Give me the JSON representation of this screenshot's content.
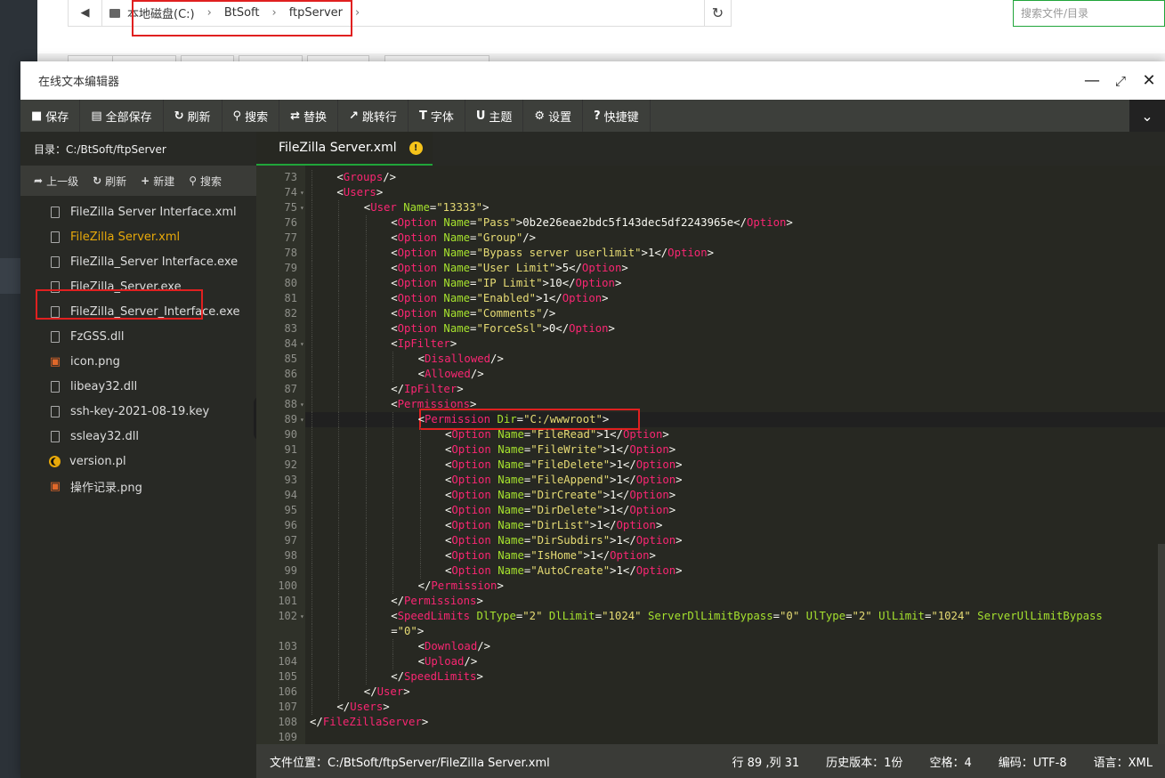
{
  "address": {
    "crumbs": [
      "本地磁盘(C:)",
      "BtSoft",
      "ftpServer"
    ],
    "search_placeholder": "搜索文件/目录"
  },
  "window": {
    "title": "在线文本编辑器"
  },
  "toolbar": [
    {
      "label": "保存",
      "icon": "save-icon"
    },
    {
      "label": "全部保存",
      "icon": "save-all-icon"
    },
    {
      "label": "刷新",
      "icon": "refresh-icon"
    },
    {
      "label": "搜索",
      "icon": "search-icon"
    },
    {
      "label": "替换",
      "icon": "replace-icon"
    },
    {
      "label": "跳转行",
      "icon": "jump-icon"
    },
    {
      "label": "字体",
      "icon": "font-icon"
    },
    {
      "label": "主题",
      "icon": "theme-icon"
    },
    {
      "label": "设置",
      "icon": "gear-icon"
    },
    {
      "label": "快捷键",
      "icon": "help-icon"
    }
  ],
  "sidebar": {
    "dir_text": "目录：C:/BtSoft/ftpServer",
    "actions": [
      "上一级",
      "刷新",
      "新建",
      "搜索"
    ],
    "files": [
      {
        "name": "FileZilla Server Interface.xml",
        "icon": "file-icon"
      },
      {
        "name": "FileZilla Server.xml",
        "icon": "file-icon"
      },
      {
        "name": "FileZilla_Server Interface.exe",
        "icon": "file-icon"
      },
      {
        "name": "FileZilla_Server.exe",
        "icon": "file-icon"
      },
      {
        "name": "FileZilla_Server_Interface.exe",
        "icon": "file-icon"
      },
      {
        "name": "FzGSS.dll",
        "icon": "file-icon"
      },
      {
        "name": "icon.png",
        "icon": "image-icon"
      },
      {
        "name": "libeay32.dll",
        "icon": "file-icon"
      },
      {
        "name": "ssh-key-2021-08-19.key",
        "icon": "file-icon"
      },
      {
        "name": "ssleay32.dll",
        "icon": "file-icon"
      },
      {
        "name": "version.pl",
        "icon": "perl-icon"
      },
      {
        "name": "操作记录.png",
        "icon": "image-icon"
      }
    ]
  },
  "tab": {
    "label": "FileZilla Server.xml"
  },
  "code_lines": [
    {
      "n": "73",
      "ind": 1,
      "fold": false,
      "parts": [
        [
          "tx",
          "<"
        ],
        [
          "tg",
          "Groups"
        ],
        [
          "tx",
          "/>"
        ]
      ]
    },
    {
      "n": "74",
      "ind": 1,
      "fold": true,
      "parts": [
        [
          "tx",
          "<"
        ],
        [
          "tg",
          "Users"
        ],
        [
          "tx",
          ">"
        ]
      ]
    },
    {
      "n": "75",
      "ind": 2,
      "fold": true,
      "parts": [
        [
          "tx",
          "<"
        ],
        [
          "tg",
          "User"
        ],
        [
          "tx",
          " "
        ],
        [
          "at",
          "Name"
        ],
        [
          "tx",
          "="
        ],
        [
          "st",
          "\"13333\""
        ],
        [
          "tx",
          ">"
        ]
      ]
    },
    {
      "n": "76",
      "ind": 3,
      "fold": false,
      "parts": [
        [
          "tx",
          "<"
        ],
        [
          "tg",
          "Option"
        ],
        [
          "tx",
          " "
        ],
        [
          "at",
          "Name"
        ],
        [
          "tx",
          "="
        ],
        [
          "st",
          "\"Pass\""
        ],
        [
          "tx",
          ">0b2e26eae2bdc5f143dec5df2243965e</"
        ],
        [
          "tg",
          "Option"
        ],
        [
          "tx",
          ">"
        ]
      ]
    },
    {
      "n": "77",
      "ind": 3,
      "fold": false,
      "parts": [
        [
          "tx",
          "<"
        ],
        [
          "tg",
          "Option"
        ],
        [
          "tx",
          " "
        ],
        [
          "at",
          "Name"
        ],
        [
          "tx",
          "="
        ],
        [
          "st",
          "\"Group\""
        ],
        [
          "tx",
          "/>"
        ]
      ]
    },
    {
      "n": "78",
      "ind": 3,
      "fold": false,
      "parts": [
        [
          "tx",
          "<"
        ],
        [
          "tg",
          "Option"
        ],
        [
          "tx",
          " "
        ],
        [
          "at",
          "Name"
        ],
        [
          "tx",
          "="
        ],
        [
          "st",
          "\"Bypass server userlimit\""
        ],
        [
          "tx",
          ">1</"
        ],
        [
          "tg",
          "Option"
        ],
        [
          "tx",
          ">"
        ]
      ]
    },
    {
      "n": "79",
      "ind": 3,
      "fold": false,
      "parts": [
        [
          "tx",
          "<"
        ],
        [
          "tg",
          "Option"
        ],
        [
          "tx",
          " "
        ],
        [
          "at",
          "Name"
        ],
        [
          "tx",
          "="
        ],
        [
          "st",
          "\"User Limit\""
        ],
        [
          "tx",
          ">5</"
        ],
        [
          "tg",
          "Option"
        ],
        [
          "tx",
          ">"
        ]
      ]
    },
    {
      "n": "80",
      "ind": 3,
      "fold": false,
      "parts": [
        [
          "tx",
          "<"
        ],
        [
          "tg",
          "Option"
        ],
        [
          "tx",
          " "
        ],
        [
          "at",
          "Name"
        ],
        [
          "tx",
          "="
        ],
        [
          "st",
          "\"IP Limit\""
        ],
        [
          "tx",
          ">10</"
        ],
        [
          "tg",
          "Option"
        ],
        [
          "tx",
          ">"
        ]
      ]
    },
    {
      "n": "81",
      "ind": 3,
      "fold": false,
      "parts": [
        [
          "tx",
          "<"
        ],
        [
          "tg",
          "Option"
        ],
        [
          "tx",
          " "
        ],
        [
          "at",
          "Name"
        ],
        [
          "tx",
          "="
        ],
        [
          "st",
          "\"Enabled\""
        ],
        [
          "tx",
          ">1</"
        ],
        [
          "tg",
          "Option"
        ],
        [
          "tx",
          ">"
        ]
      ]
    },
    {
      "n": "82",
      "ind": 3,
      "fold": false,
      "parts": [
        [
          "tx",
          "<"
        ],
        [
          "tg",
          "Option"
        ],
        [
          "tx",
          " "
        ],
        [
          "at",
          "Name"
        ],
        [
          "tx",
          "="
        ],
        [
          "st",
          "\"Comments\""
        ],
        [
          "tx",
          "/>"
        ]
      ]
    },
    {
      "n": "83",
      "ind": 3,
      "fold": false,
      "parts": [
        [
          "tx",
          "<"
        ],
        [
          "tg",
          "Option"
        ],
        [
          "tx",
          " "
        ],
        [
          "at",
          "Name"
        ],
        [
          "tx",
          "="
        ],
        [
          "st",
          "\"ForceSsl\""
        ],
        [
          "tx",
          ">0</"
        ],
        [
          "tg",
          "Option"
        ],
        [
          "tx",
          ">"
        ]
      ]
    },
    {
      "n": "84",
      "ind": 3,
      "fold": true,
      "parts": [
        [
          "tx",
          "<"
        ],
        [
          "tg",
          "IpFilter"
        ],
        [
          "tx",
          ">"
        ]
      ]
    },
    {
      "n": "85",
      "ind": 4,
      "fold": false,
      "parts": [
        [
          "tx",
          "<"
        ],
        [
          "tg",
          "Disallowed"
        ],
        [
          "tx",
          "/>"
        ]
      ]
    },
    {
      "n": "86",
      "ind": 4,
      "fold": false,
      "parts": [
        [
          "tx",
          "<"
        ],
        [
          "tg",
          "Allowed"
        ],
        [
          "tx",
          "/>"
        ]
      ]
    },
    {
      "n": "87",
      "ind": 3,
      "fold": false,
      "parts": [
        [
          "tx",
          "</"
        ],
        [
          "tg",
          "IpFilter"
        ],
        [
          "tx",
          ">"
        ]
      ]
    },
    {
      "n": "88",
      "ind": 3,
      "fold": true,
      "parts": [
        [
          "tx",
          "<"
        ],
        [
          "tg",
          "Permissions"
        ],
        [
          "tx",
          ">"
        ]
      ]
    },
    {
      "n": "89",
      "ind": 4,
      "fold": true,
      "parts": [
        [
          "tx",
          "<"
        ],
        [
          "tg",
          "Permission"
        ],
        [
          "tx",
          " "
        ],
        [
          "at",
          "Dir"
        ],
        [
          "tx",
          "="
        ],
        [
          "st",
          "\"C:/wwwroot\""
        ],
        [
          "tx",
          ">"
        ]
      ]
    },
    {
      "n": "90",
      "ind": 5,
      "fold": false,
      "parts": [
        [
          "tx",
          "<"
        ],
        [
          "tg",
          "Option"
        ],
        [
          "tx",
          " "
        ],
        [
          "at",
          "Name"
        ],
        [
          "tx",
          "="
        ],
        [
          "st",
          "\"FileRead\""
        ],
        [
          "tx",
          ">1</"
        ],
        [
          "tg",
          "Option"
        ],
        [
          "tx",
          ">"
        ]
      ]
    },
    {
      "n": "91",
      "ind": 5,
      "fold": false,
      "parts": [
        [
          "tx",
          "<"
        ],
        [
          "tg",
          "Option"
        ],
        [
          "tx",
          " "
        ],
        [
          "at",
          "Name"
        ],
        [
          "tx",
          "="
        ],
        [
          "st",
          "\"FileWrite\""
        ],
        [
          "tx",
          ">1</"
        ],
        [
          "tg",
          "Option"
        ],
        [
          "tx",
          ">"
        ]
      ]
    },
    {
      "n": "92",
      "ind": 5,
      "fold": false,
      "parts": [
        [
          "tx",
          "<"
        ],
        [
          "tg",
          "Option"
        ],
        [
          "tx",
          " "
        ],
        [
          "at",
          "Name"
        ],
        [
          "tx",
          "="
        ],
        [
          "st",
          "\"FileDelete\""
        ],
        [
          "tx",
          ">1</"
        ],
        [
          "tg",
          "Option"
        ],
        [
          "tx",
          ">"
        ]
      ]
    },
    {
      "n": "93",
      "ind": 5,
      "fold": false,
      "parts": [
        [
          "tx",
          "<"
        ],
        [
          "tg",
          "Option"
        ],
        [
          "tx",
          " "
        ],
        [
          "at",
          "Name"
        ],
        [
          "tx",
          "="
        ],
        [
          "st",
          "\"FileAppend\""
        ],
        [
          "tx",
          ">1</"
        ],
        [
          "tg",
          "Option"
        ],
        [
          "tx",
          ">"
        ]
      ]
    },
    {
      "n": "94",
      "ind": 5,
      "fold": false,
      "parts": [
        [
          "tx",
          "<"
        ],
        [
          "tg",
          "Option"
        ],
        [
          "tx",
          " "
        ],
        [
          "at",
          "Name"
        ],
        [
          "tx",
          "="
        ],
        [
          "st",
          "\"DirCreate\""
        ],
        [
          "tx",
          ">1</"
        ],
        [
          "tg",
          "Option"
        ],
        [
          "tx",
          ">"
        ]
      ]
    },
    {
      "n": "95",
      "ind": 5,
      "fold": false,
      "parts": [
        [
          "tx",
          "<"
        ],
        [
          "tg",
          "Option"
        ],
        [
          "tx",
          " "
        ],
        [
          "at",
          "Name"
        ],
        [
          "tx",
          "="
        ],
        [
          "st",
          "\"DirDelete\""
        ],
        [
          "tx",
          ">1</"
        ],
        [
          "tg",
          "Option"
        ],
        [
          "tx",
          ">"
        ]
      ]
    },
    {
      "n": "96",
      "ind": 5,
      "fold": false,
      "parts": [
        [
          "tx",
          "<"
        ],
        [
          "tg",
          "Option"
        ],
        [
          "tx",
          " "
        ],
        [
          "at",
          "Name"
        ],
        [
          "tx",
          "="
        ],
        [
          "st",
          "\"DirList\""
        ],
        [
          "tx",
          ">1</"
        ],
        [
          "tg",
          "Option"
        ],
        [
          "tx",
          ">"
        ]
      ]
    },
    {
      "n": "97",
      "ind": 5,
      "fold": false,
      "parts": [
        [
          "tx",
          "<"
        ],
        [
          "tg",
          "Option"
        ],
        [
          "tx",
          " "
        ],
        [
          "at",
          "Name"
        ],
        [
          "tx",
          "="
        ],
        [
          "st",
          "\"DirSubdirs\""
        ],
        [
          "tx",
          ">1</"
        ],
        [
          "tg",
          "Option"
        ],
        [
          "tx",
          ">"
        ]
      ]
    },
    {
      "n": "98",
      "ind": 5,
      "fold": false,
      "parts": [
        [
          "tx",
          "<"
        ],
        [
          "tg",
          "Option"
        ],
        [
          "tx",
          " "
        ],
        [
          "at",
          "Name"
        ],
        [
          "tx",
          "="
        ],
        [
          "st",
          "\"IsHome\""
        ],
        [
          "tx",
          ">1</"
        ],
        [
          "tg",
          "Option"
        ],
        [
          "tx",
          ">"
        ]
      ]
    },
    {
      "n": "99",
      "ind": 5,
      "fold": false,
      "parts": [
        [
          "tx",
          "<"
        ],
        [
          "tg",
          "Option"
        ],
        [
          "tx",
          " "
        ],
        [
          "at",
          "Name"
        ],
        [
          "tx",
          "="
        ],
        [
          "st",
          "\"AutoCreate\""
        ],
        [
          "tx",
          ">1</"
        ],
        [
          "tg",
          "Option"
        ],
        [
          "tx",
          ">"
        ]
      ]
    },
    {
      "n": "100",
      "ind": 4,
      "fold": false,
      "parts": [
        [
          "tx",
          "</"
        ],
        [
          "tg",
          "Permission"
        ],
        [
          "tx",
          ">"
        ]
      ]
    },
    {
      "n": "101",
      "ind": 3,
      "fold": false,
      "parts": [
        [
          "tx",
          "</"
        ],
        [
          "tg",
          "Permissions"
        ],
        [
          "tx",
          ">"
        ]
      ]
    },
    {
      "n": "102",
      "ind": 3,
      "fold": true,
      "parts": [
        [
          "tx",
          "<"
        ],
        [
          "tg",
          "SpeedLimits"
        ],
        [
          "tx",
          " "
        ],
        [
          "at",
          "DlType"
        ],
        [
          "tx",
          "="
        ],
        [
          "st",
          "\"2\""
        ],
        [
          "tx",
          " "
        ],
        [
          "at",
          "DlLimit"
        ],
        [
          "tx",
          "="
        ],
        [
          "st",
          "\"1024\""
        ],
        [
          "tx",
          " "
        ],
        [
          "at",
          "ServerDlLimitBypass"
        ],
        [
          "tx",
          "="
        ],
        [
          "st",
          "\"0\""
        ],
        [
          "tx",
          " "
        ],
        [
          "at",
          "UlType"
        ],
        [
          "tx",
          "="
        ],
        [
          "st",
          "\"2\""
        ],
        [
          "tx",
          " "
        ],
        [
          "at",
          "UlLimit"
        ],
        [
          "tx",
          "="
        ],
        [
          "st",
          "\"1024\""
        ],
        [
          "tx",
          " "
        ],
        [
          "at",
          "ServerUlLimitBypass"
        ]
      ]
    },
    {
      "n": "",
      "ind": 3,
      "fold": false,
      "parts": [
        [
          "tx",
          "="
        ],
        [
          "st",
          "\"0\""
        ],
        [
          "tx",
          ">"
        ]
      ]
    },
    {
      "n": "103",
      "ind": 4,
      "fold": false,
      "parts": [
        [
          "tx",
          "<"
        ],
        [
          "tg",
          "Download"
        ],
        [
          "tx",
          "/>"
        ]
      ]
    },
    {
      "n": "104",
      "ind": 4,
      "fold": false,
      "parts": [
        [
          "tx",
          "<"
        ],
        [
          "tg",
          "Upload"
        ],
        [
          "tx",
          "/>"
        ]
      ]
    },
    {
      "n": "105",
      "ind": 3,
      "fold": false,
      "parts": [
        [
          "tx",
          "</"
        ],
        [
          "tg",
          "SpeedLimits"
        ],
        [
          "tx",
          ">"
        ]
      ]
    },
    {
      "n": "106",
      "ind": 2,
      "fold": false,
      "parts": [
        [
          "tx",
          "</"
        ],
        [
          "tg",
          "User"
        ],
        [
          "tx",
          ">"
        ]
      ]
    },
    {
      "n": "107",
      "ind": 1,
      "fold": false,
      "parts": [
        [
          "tx",
          "</"
        ],
        [
          "tg",
          "Users"
        ],
        [
          "tx",
          ">"
        ]
      ]
    },
    {
      "n": "108",
      "ind": 0,
      "fold": false,
      "parts": [
        [
          "tx",
          "</"
        ],
        [
          "tg",
          "FileZillaServer"
        ],
        [
          "tx",
          ">"
        ]
      ]
    },
    {
      "n": "109",
      "ind": 0,
      "fold": false,
      "parts": []
    }
  ],
  "highlight_line": "89",
  "status": {
    "path": "文件位置：C:/BtSoft/ftpServer/FileZilla Server.xml",
    "cursor": "行 89 ,列 31",
    "history": "历史版本：1份",
    "spaces": "空格：4",
    "encoding": "编码：UTF-8",
    "language": "语言：XML"
  },
  "colors": {
    "accent": "#20a53a",
    "highlight_box": "#e02020",
    "tag": "#f92672",
    "attr": "#a6e22e",
    "string": "#e6db74"
  }
}
